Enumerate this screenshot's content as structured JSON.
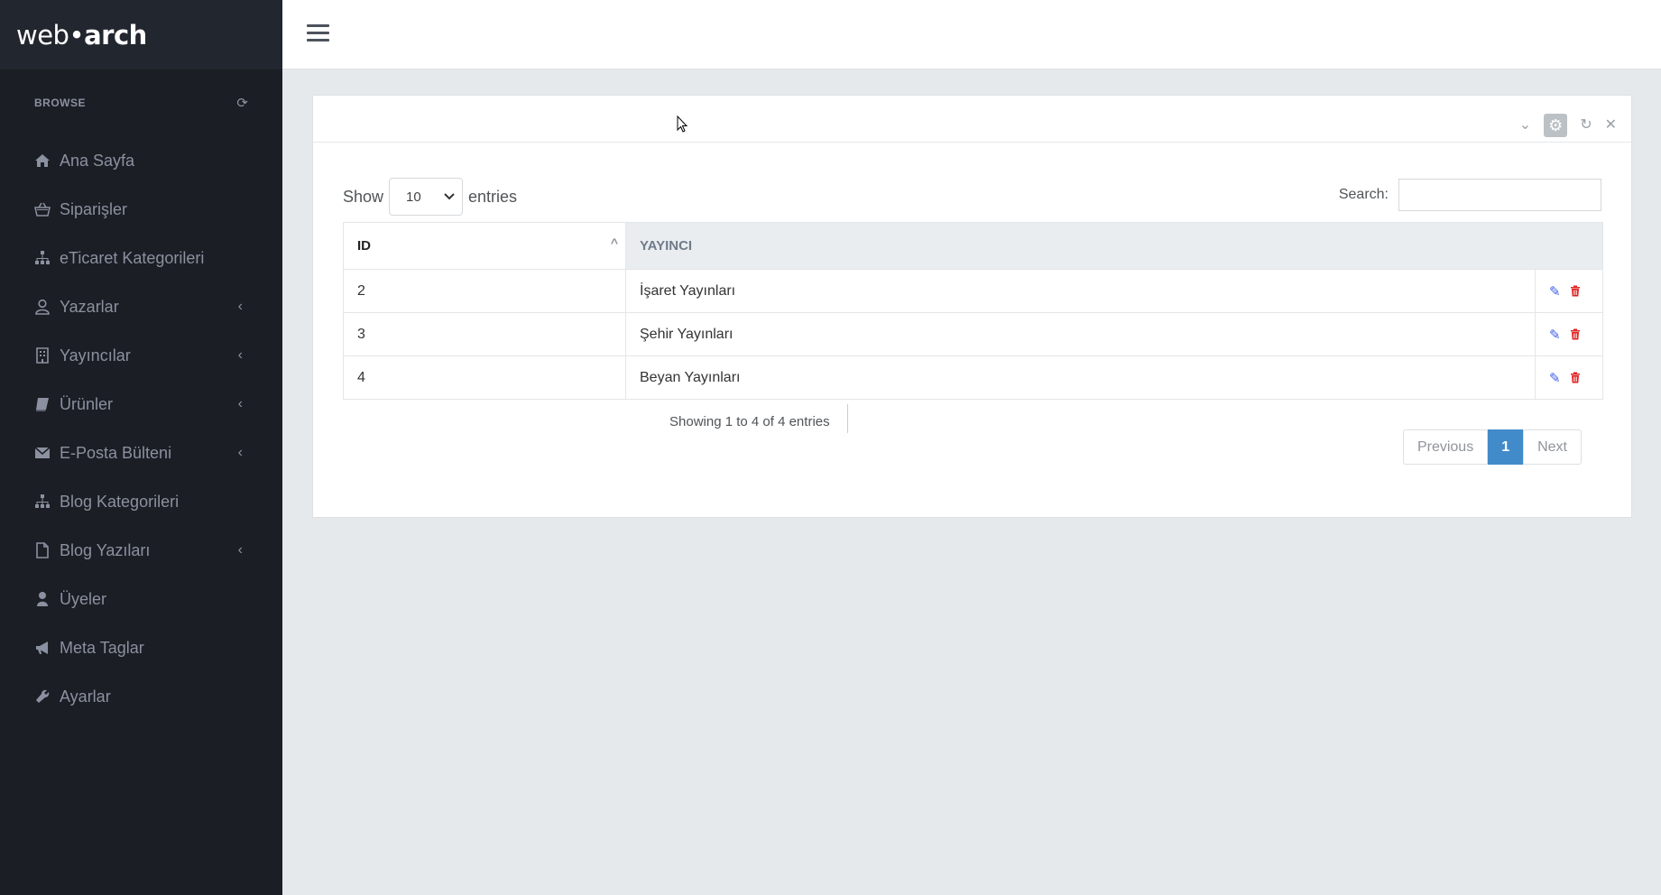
{
  "brand": {
    "part1": "web",
    "dot": "•",
    "part2": "arch"
  },
  "sidebar": {
    "section_label": "BROWSE",
    "items": [
      {
        "label": "Ana Sayfa",
        "icon": "home-icon",
        "has_submenu": false
      },
      {
        "label": "Siparişler",
        "icon": "basket-icon",
        "has_submenu": false
      },
      {
        "label": "eTicaret Kategorileri",
        "icon": "sitemap-icon",
        "has_submenu": false
      },
      {
        "label": "Yazarlar",
        "icon": "user-icon",
        "has_submenu": true
      },
      {
        "label": "Yayıncılar",
        "icon": "building-icon",
        "has_submenu": true
      },
      {
        "label": "Ürünler",
        "icon": "book-icon",
        "has_submenu": true
      },
      {
        "label": "E-Posta Bülteni",
        "icon": "envelope-icon",
        "has_submenu": true
      },
      {
        "label": "Blog Kategorileri",
        "icon": "sitemap-icon",
        "has_submenu": false
      },
      {
        "label": "Blog Yazıları",
        "icon": "file-icon",
        "has_submenu": true
      },
      {
        "label": "Üyeler",
        "icon": "user-solid-icon",
        "has_submenu": false
      },
      {
        "label": "Meta Taglar",
        "icon": "bullhorn-icon",
        "has_submenu": false
      },
      {
        "label": "Ayarlar",
        "icon": "wrench-icon",
        "has_submenu": false
      }
    ]
  },
  "table_controls": {
    "show_label": "Show",
    "entries_value": "10",
    "entries_label": "entries",
    "search_label": "Search:",
    "search_value": ""
  },
  "table": {
    "columns": [
      "ID",
      "YAYINCI"
    ],
    "rows": [
      {
        "id": "2",
        "publisher": "İşaret Yayınları"
      },
      {
        "id": "3",
        "publisher": "Şehir Yayınları"
      },
      {
        "id": "4",
        "publisher": "Beyan Yayınları"
      }
    ]
  },
  "footer": {
    "info": "Showing 1 to 4 of 4 entries",
    "pagination": {
      "previous": "Previous",
      "current": "1",
      "next": "Next"
    }
  },
  "colors": {
    "sidebar_bg": "#1b1e24",
    "accent": "#428bca",
    "edit": "#3f5fe8",
    "delete": "#e02424"
  }
}
